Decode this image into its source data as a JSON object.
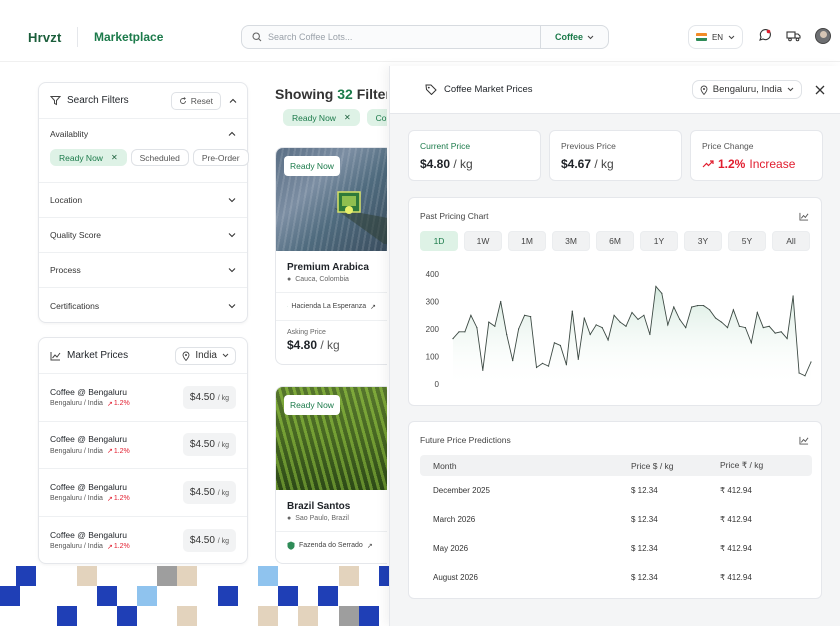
{
  "header": {
    "logo": "Hrvzt",
    "nav_marketplace": "Marketplace",
    "search_placeholder": "Search Coffee Lots...",
    "search_category": "Coffee",
    "language": "EN"
  },
  "filters": {
    "title": "Search Filters",
    "reset_label": "Reset",
    "availability": {
      "label": "Availablity",
      "options": [
        "Ready Now",
        "Scheduled",
        "Pre-Order"
      ],
      "selected": "Ready Now"
    },
    "sections": [
      "Location",
      "Quality Score",
      "Process",
      "Certifications"
    ]
  },
  "market_prices": {
    "title": "Market Prices",
    "region": "India",
    "rows": [
      {
        "name": "Coffee @ Bengaluru",
        "location": "Bengaluru / India",
        "change": "1.2%",
        "price": "$4.50",
        "unit": "/ kg"
      },
      {
        "name": "Coffee @ Bengaluru",
        "location": "Bengaluru / India",
        "change": "1.2%",
        "price": "$4.50",
        "unit": "/ kg"
      },
      {
        "name": "Coffee @ Bengaluru",
        "location": "Bengaluru / India",
        "change": "1.2%",
        "price": "$4.50",
        "unit": "/ kg"
      },
      {
        "name": "Coffee @ Bengaluru",
        "location": "Bengaluru / India",
        "change": "1.2%",
        "price": "$4.50",
        "unit": "/ kg"
      }
    ]
  },
  "listing": {
    "showing_prefix": "Showing",
    "count": "32",
    "showing_suffix": "Filtered",
    "active_chips": [
      "Ready Now",
      "Col"
    ],
    "cards": [
      {
        "badge": "Ready Now",
        "title": "Premium Arabica",
        "location": "Cauca, Colombia",
        "farm": "Hacienda La Esperanza",
        "asking_label": "Asking Price",
        "price": "$4.80",
        "unit": "/ kg"
      },
      {
        "badge": "Ready Now",
        "title": "Brazil Santos",
        "location": "Sao Paulo, Brazil",
        "farm": "Fazenda do Serrado"
      }
    ]
  },
  "panel": {
    "title": "Coffee Market Prices",
    "location": "Bengaluru, India",
    "current_price": {
      "label": "Current Price",
      "value": "$4.80",
      "unit": "/ kg"
    },
    "previous_price": {
      "label": "Previous Price",
      "value": "$4.67",
      "unit": "/ kg"
    },
    "price_change": {
      "label": "Price Change",
      "value": "1.2%",
      "suffix": "Increase"
    },
    "chart_title": "Past Pricing Chart",
    "ranges": [
      "1D",
      "1W",
      "1M",
      "3M",
      "6M",
      "1Y",
      "3Y",
      "5Y",
      "All"
    ],
    "active_range": "1D",
    "predictions": {
      "title": "Future Price Predictions",
      "headers": [
        "Month",
        "Price  $ / kg",
        "Price  ₹ / kg"
      ],
      "rows": [
        {
          "month": "December 2025",
          "usd": "$ 12.34",
          "inr": "₹ 412.94"
        },
        {
          "month": "March 2026",
          "usd": "$ 12.34",
          "inr": "₹ 412.94"
        },
        {
          "month": "May 2026",
          "usd": "$ 12.34",
          "inr": "₹ 412.94"
        },
        {
          "month": "August 2026",
          "usd": "$ 12.34",
          "inr": "₹ 412.94"
        }
      ]
    }
  },
  "colors": {
    "brand": "#1b7a4a",
    "accent_bg": "#def2e6",
    "negative": "#e11d2e"
  },
  "chart_data": {
    "type": "area",
    "title": "Past Pricing Chart",
    "ylim": [
      0,
      400
    ],
    "y_ticks": [
      400,
      300,
      200,
      100,
      0
    ],
    "values": [
      165,
      190,
      190,
      250,
      205,
      50,
      225,
      210,
      300,
      180,
      85,
      200,
      250,
      245,
      60,
      75,
      65,
      150,
      140,
      70,
      265,
      90,
      240,
      180,
      215,
      205,
      160,
      250,
      225,
      210,
      260,
      235,
      250,
      180,
      355,
      330,
      215,
      280,
      235,
      205,
      280,
      285,
      285,
      270,
      240,
      225,
      205,
      270,
      210,
      205,
      150,
      260,
      205,
      210,
      185,
      190,
      165,
      320,
      40,
      30,
      80
    ]
  }
}
